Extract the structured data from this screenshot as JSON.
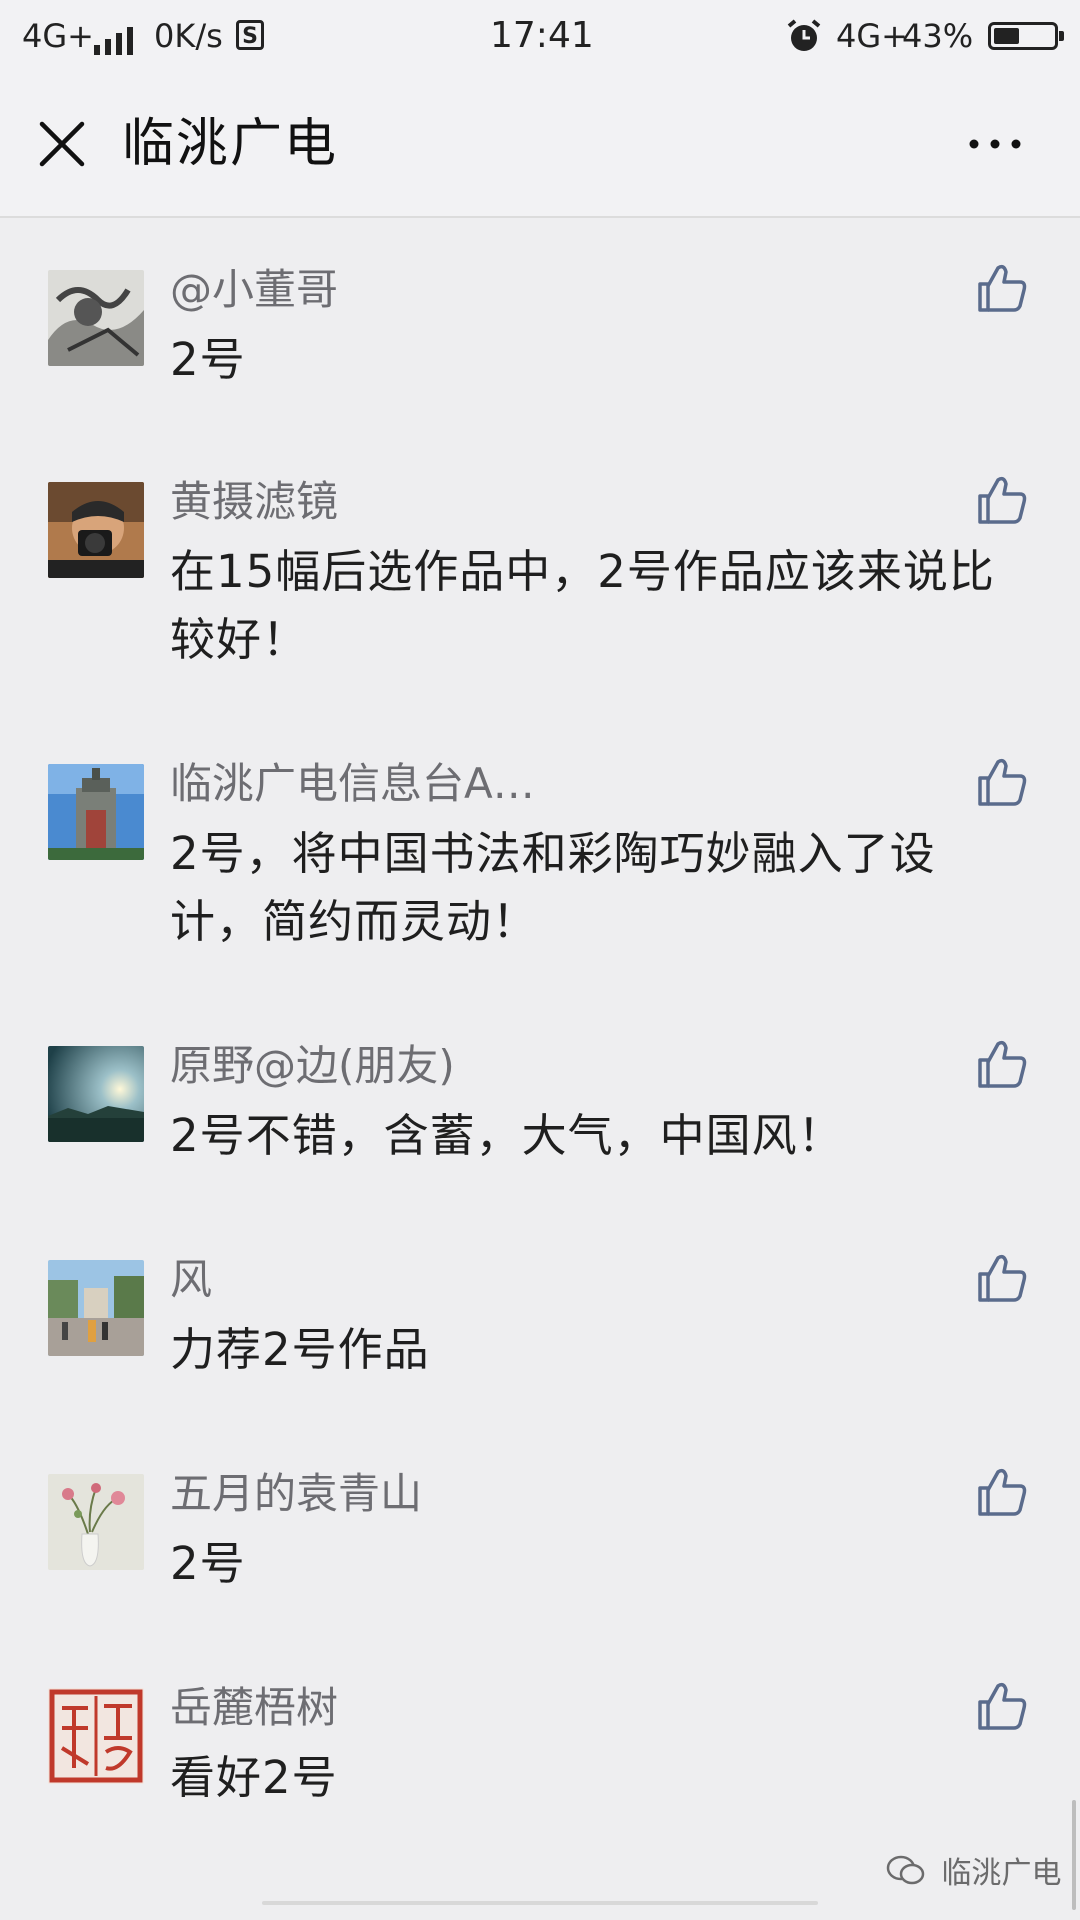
{
  "status_bar": {
    "network": "4G+",
    "speed": "0K/s",
    "s_badge": "S",
    "time": "17:41",
    "network_right": "4G+",
    "battery_percent": "43%",
    "battery_level": 0.43
  },
  "nav": {
    "title": "临洮广电",
    "close_icon": "close-icon",
    "more_icon": "more-icon"
  },
  "comments": [
    {
      "nickname": "@小董哥",
      "content": "2号",
      "avatar": "ink-painting-avatar"
    },
    {
      "nickname": "黄摄滤镜",
      "content": "在15幅后选作品中，2号作品应该来说比较好！",
      "avatar": "photographer-avatar"
    },
    {
      "nickname": "临洮广电信息台A…",
      "content": "2号，将中国书法和彩陶巧妙融入了设计，简约而灵动！",
      "avatar": "tower-avatar"
    },
    {
      "nickname": "原野@边(朋友)",
      "content": "2号不错，含蓄，大气，中国风！",
      "avatar": "sunset-avatar"
    },
    {
      "nickname": "风",
      "content": "力荐2号作品",
      "avatar": "street-avatar"
    },
    {
      "nickname": "五月的袁青山",
      "content": "2号",
      "avatar": "flower-vase-avatar"
    },
    {
      "nickname": "岳麓梧树",
      "content": "看好2号",
      "avatar": "seal-stamp-avatar"
    }
  ],
  "watermark": {
    "text": "临洮广电"
  },
  "colors": {
    "background": "#eeeef0",
    "nickname": "#6d6d72",
    "like_icon": "#5a6b8c"
  }
}
